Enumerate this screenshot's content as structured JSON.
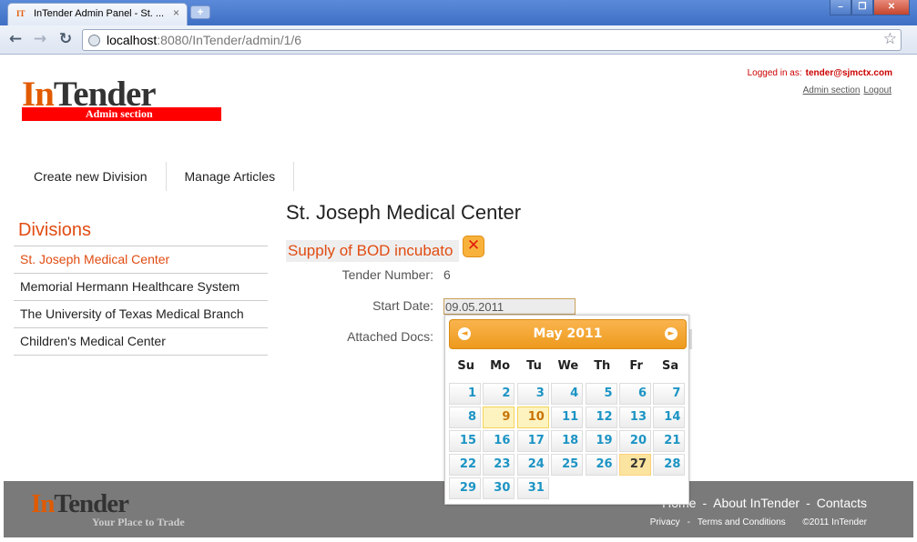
{
  "browser": {
    "tab_title": "InTender Admin Panel - St. ...",
    "tab_favicon": "IT",
    "tab_close": "×",
    "new_tab": "+",
    "url_host": "localhost",
    "url_rest": ":8080/InTender/admin/1/6",
    "back_icon": "arrow-left-icon",
    "forward_icon": "arrow-right-icon",
    "reload_icon": "reload-icon",
    "star_icon": "star-icon"
  },
  "header": {
    "logo_part1": "In",
    "logo_part2": "Tender",
    "logo_sub": "Admin section",
    "logged_in_label": "Logged in as:",
    "logged_in_user": "tender@sjmctx.com",
    "admin_section_link": "Admin section",
    "logout_link": "Logout"
  },
  "topnav": {
    "create_division": "Create new Division",
    "manage_articles": "Manage Articles"
  },
  "sidebar": {
    "title": "Divisions",
    "items": [
      {
        "label": "St. Joseph Medical Center"
      },
      {
        "label": "Memorial Hermann Healthcare System"
      },
      {
        "label": "The University of Texas Medical Branch"
      },
      {
        "label": "Children's Medical Center"
      }
    ]
  },
  "main": {
    "division_title": "St. Joseph Medical Center",
    "tender_title": "Supply of BOD incubato",
    "tender_number_label": "Tender Number:",
    "tender_number_value": "6",
    "start_date_label": "Start Date:",
    "start_date_value": "09.05.2011",
    "attached_docs_label": "Attached Docs:"
  },
  "datepicker": {
    "title": "May 2011",
    "prev": "◄",
    "next": "►",
    "dow": [
      "Su",
      "Mo",
      "Tu",
      "We",
      "Th",
      "Fr",
      "Sa"
    ],
    "today": 10,
    "selected": 9,
    "highlight": 27,
    "days": [
      1,
      2,
      3,
      4,
      5,
      6,
      7,
      8,
      9,
      10,
      11,
      12,
      13,
      14,
      15,
      16,
      17,
      18,
      19,
      20,
      21,
      22,
      23,
      24,
      25,
      26,
      27,
      28,
      29,
      30,
      31
    ]
  },
  "footer": {
    "logo_part1": "In",
    "logo_part2": "Tender",
    "slogan": "Your Place to Trade",
    "links": [
      "Home",
      "About InTender",
      "Contacts"
    ],
    "small_links": [
      "Privacy",
      "Terms and Conditions",
      "©2011 InTender"
    ]
  },
  "colors": {
    "accent": "#e14c12",
    "logo_red": "#ff0000",
    "datepicker_header": "#f29d21",
    "day_text": "#1c94c4",
    "footer_bg": "#7b7a7a"
  }
}
